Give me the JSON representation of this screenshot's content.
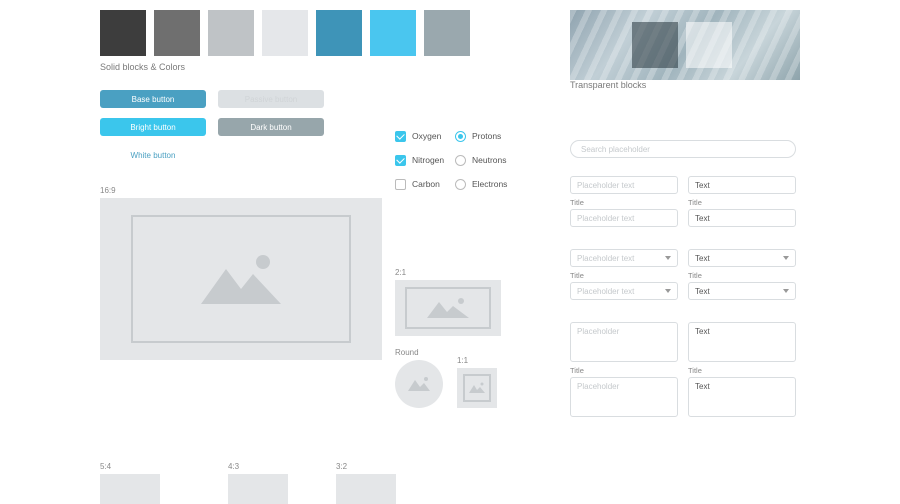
{
  "palette": {
    "caption": "Solid blocks & Colors",
    "colors": [
      "#3d3d3d",
      "#6f6f6f",
      "#bfc3c6",
      "#e5e7ea",
      "#3e94b8",
      "#4ac6ef",
      "#9aa8ae"
    ]
  },
  "transparent": {
    "caption": "Transparent blocks"
  },
  "buttons": {
    "base": "Base button",
    "passive": "Passive button",
    "bright": "Bright button",
    "dark": "Dark button",
    "white": "White button"
  },
  "checkboxes": [
    {
      "label": "Oxygen",
      "checked": true
    },
    {
      "label": "Nitrogen",
      "checked": true
    },
    {
      "label": "Carbon",
      "checked": false
    }
  ],
  "radios": [
    {
      "label": "Protons",
      "selected": true
    },
    {
      "label": "Neutrons",
      "selected": false
    },
    {
      "label": "Electrons",
      "selected": false
    }
  ],
  "aspect": {
    "r169": "16:9",
    "r21": "2:1",
    "round": "Round",
    "r11": "1:1",
    "r54": "5:4",
    "r43": "4:3",
    "r32": "3:2"
  },
  "search": {
    "placeholder": "Search placeholder"
  },
  "form": {
    "placeholder": "Placeholder text",
    "value": "Text",
    "title": "Title",
    "ta_placeholder": "Placeholder"
  }
}
